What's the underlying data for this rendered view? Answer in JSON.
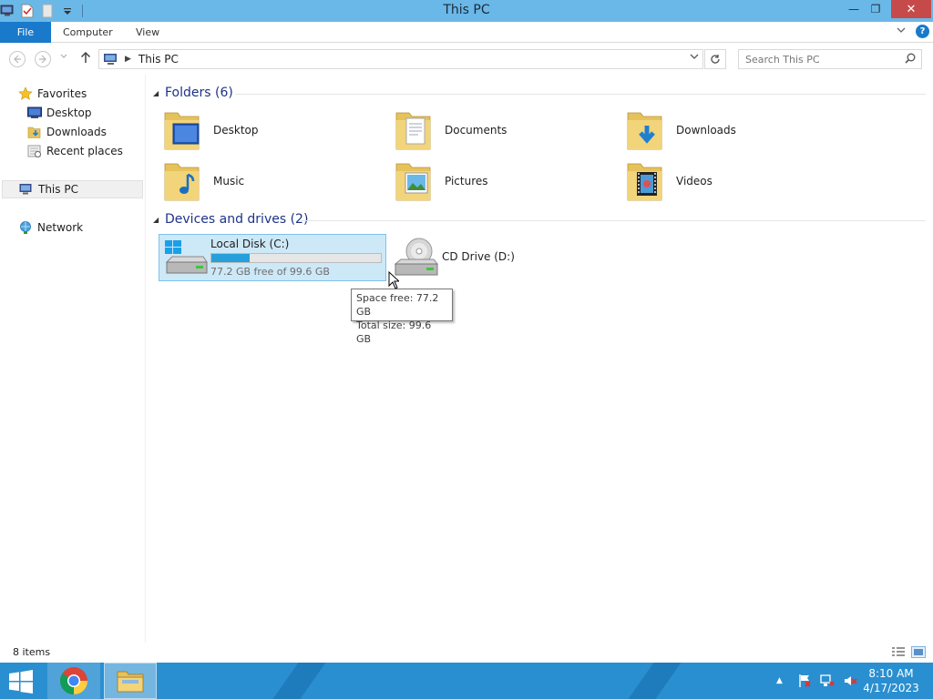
{
  "window": {
    "title": "This PC",
    "minimize_glyph": "—",
    "maximize_glyph": "❐",
    "close_glyph": "✕"
  },
  "ribbon": {
    "tabs": [
      "File",
      "Computer",
      "View"
    ],
    "help_glyph": "?"
  },
  "nav": {
    "address_path": "This PC",
    "search_placeholder": "Search This PC"
  },
  "sidebar": {
    "favorites": "Favorites",
    "favorites_items": [
      "Desktop",
      "Downloads",
      "Recent places"
    ],
    "this_pc": "This PC",
    "network": "Network"
  },
  "content": {
    "folders_header": "Folders (6)",
    "folders": [
      "Desktop",
      "Documents",
      "Downloads",
      "Music",
      "Pictures",
      "Videos"
    ],
    "devices_header": "Devices and drives (2)",
    "drives": [
      {
        "name": "Local Disk (C:)",
        "subtitle": "77.2 GB free of 99.6 GB",
        "used_fraction": 0.225
      },
      {
        "name": "CD Drive (D:)"
      }
    ],
    "tooltip": {
      "line1": "Space free: 77.2 GB",
      "line2": "Total size: 99.6 GB"
    }
  },
  "status": {
    "item_count": "8 items"
  },
  "taskbar": {
    "time": "8:10 AM",
    "date": "4/17/2023"
  },
  "colors": {
    "titlebar": "#6ab8e8",
    "accent": "#1979ca",
    "section_header": "#1e3287",
    "selection": "#cde8f7",
    "progress": "#26a0da",
    "taskbar": "#2a8fd0",
    "close": "#c74a4a"
  }
}
